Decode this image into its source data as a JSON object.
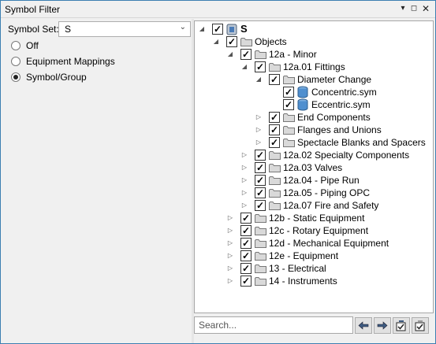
{
  "window": {
    "title": "Symbol Filter"
  },
  "titlebar_buttons": {
    "pin": "▾",
    "maximize": "◻",
    "close": "✕"
  },
  "symbol_set": {
    "label": "Symbol Set:",
    "value": "S",
    "arrow": "⌄"
  },
  "radios": [
    {
      "label": "Off",
      "selected": false
    },
    {
      "label": "Equipment Mappings",
      "selected": false
    },
    {
      "label": "Symbol/Group",
      "selected": true
    }
  ],
  "tree": {
    "root": {
      "label": "S"
    },
    "objects": {
      "label": "Objects"
    },
    "n12a": {
      "label": "12a - Minor"
    },
    "n12a01": {
      "label": "12a.01 Fittings"
    },
    "diameter_change": {
      "label": "Diameter Change"
    },
    "concentric": {
      "label": "Concentric.sym"
    },
    "eccentric": {
      "label": "Eccentric.sym"
    },
    "end_components": {
      "label": "End Components"
    },
    "flanges": {
      "label": "Flanges and Unions"
    },
    "spectacle": {
      "label": "Spectacle Blanks and Spacers"
    },
    "n12a02": {
      "label": "12a.02 Specialty Components"
    },
    "n12a03": {
      "label": "12a.03 Valves"
    },
    "n12a04": {
      "label": "12a.04 - Pipe Run"
    },
    "n12a05": {
      "label": "12a.05 - Piping OPC"
    },
    "n12a07": {
      "label": "12a.07 Fire and Safety"
    },
    "n12b": {
      "label": "12b - Static Equipment"
    },
    "n12c": {
      "label": "12c - Rotary Equipment"
    },
    "n12d": {
      "label": "12d - Mechanical Equipment"
    },
    "n12e": {
      "label": "12e - Equipment"
    },
    "n13": {
      "label": "13 - Electrical"
    },
    "n14": {
      "label": "14 - Instruments"
    }
  },
  "glyphs": {
    "expanded": "◢",
    "collapsed": "▷",
    "check": "✓"
  },
  "search": {
    "placeholder": "Search..."
  },
  "toolbar": [
    "arrow-left-icon",
    "arrow-right-icon",
    "check-all-icon",
    "uncheck-all-icon"
  ]
}
